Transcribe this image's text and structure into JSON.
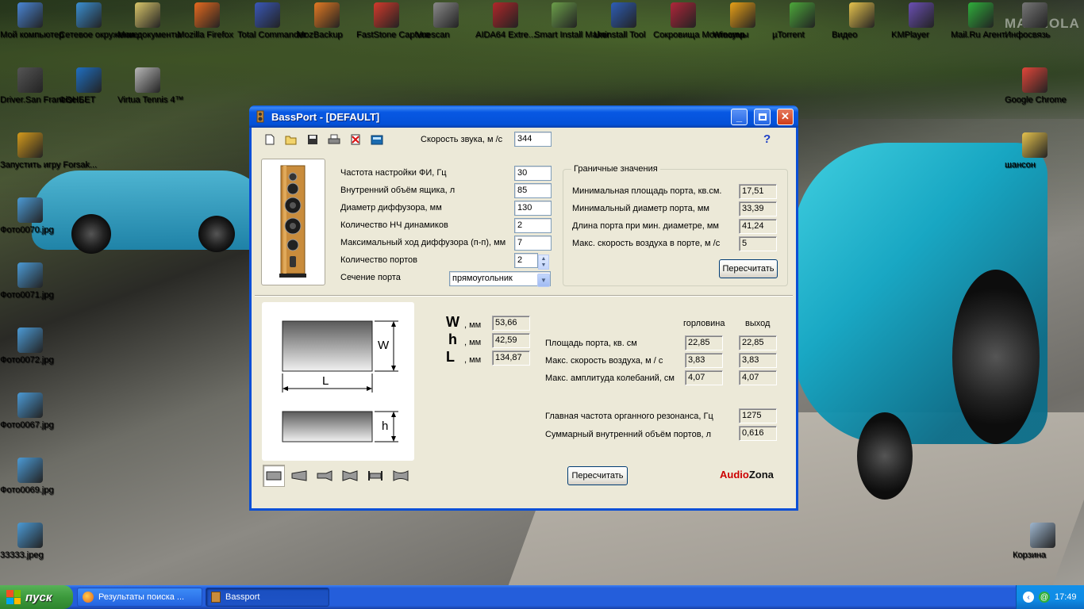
{
  "desktop": {
    "icons": [
      {
        "label": "Мой компьютер",
        "icon": "my-computer-icon",
        "color": "#4a86d6"
      },
      {
        "label": "Сетевое окружение",
        "icon": "network-icon",
        "color": "#3b8fd1"
      },
      {
        "label": "Мои документы",
        "icon": "documents-icon",
        "color": "#d9c66a"
      },
      {
        "label": "Mozilla Firefox",
        "icon": "firefox-icon",
        "color": "#e66a1f"
      },
      {
        "label": "Total Commander",
        "icon": "floppy-icon",
        "color": "#3a58b8"
      },
      {
        "label": "MozBackup",
        "icon": "mozbackup-icon",
        "color": "#e37a23"
      },
      {
        "label": "FastStone Capture",
        "icon": "faststone-icon",
        "color": "#d33a2c"
      },
      {
        "label": "Vuescan",
        "icon": "scanner-icon",
        "color": "#8a8a8a"
      },
      {
        "label": "AIDA64 Extre...",
        "icon": "aida64-icon",
        "color": "#b0272a"
      },
      {
        "label": "Smart Install Maker",
        "icon": "installer-icon",
        "color": "#6ca04a"
      },
      {
        "label": "Uninstall Tool",
        "icon": "uninstall-icon",
        "color": "#2e5db5"
      },
      {
        "label": "Сокровища Монтесумы",
        "icon": "game-icon",
        "color": "#b0263a"
      },
      {
        "label": "Winamp",
        "icon": "winamp-icon",
        "color": "#e8a017"
      },
      {
        "label": "µTorrent",
        "icon": "utorrent-icon",
        "color": "#4ca83a"
      },
      {
        "label": "Видео",
        "icon": "folder-icon",
        "color": "#e6c34d"
      },
      {
        "label": "KMPlayer",
        "icon": "kmplayer-icon",
        "color": "#6a4fb3"
      },
      {
        "label": "Mail.Ru Агент",
        "icon": "mailru-agent-icon",
        "color": "#2fae3b"
      },
      {
        "label": "Инфосвязь",
        "icon": "infosvyaz-icon",
        "color": "#777777"
      },
      {
        "label": "Driver.San Francisc...",
        "icon": "driver-game-icon",
        "color": "#555555"
      },
      {
        "label": "ФОНБЕТ",
        "icon": "fonbet-icon",
        "color": "#1f6fc2"
      },
      {
        "label": "Virtua Tennis 4™",
        "icon": "tennis-game-icon",
        "color": "#b8b8b8"
      },
      {
        "label": "Запустить игру Forsak...",
        "icon": "forsaken-game-icon",
        "color": "#d59b1c"
      },
      {
        "label": "Фото0070.jpg",
        "icon": "image-file-icon",
        "color": "#4c9bd6"
      },
      {
        "label": "Фото0071.jpg",
        "icon": "image-file-icon",
        "color": "#4c9bd6"
      },
      {
        "label": "Фото0072.jpg",
        "icon": "image-file-icon",
        "color": "#4c9bd6"
      },
      {
        "label": "Фото0067.jpg",
        "icon": "image-file-icon",
        "color": "#4c9bd6"
      },
      {
        "label": "Фото0069.jpg",
        "icon": "image-file-icon",
        "color": "#4c9bd6"
      },
      {
        "label": "33333.jpeg",
        "icon": "image-file-icon",
        "color": "#4c9bd6"
      },
      {
        "label": "Google Chrome",
        "icon": "chrome-icon",
        "color": "#e2463a"
      },
      {
        "label": "шансон",
        "icon": "folder-icon",
        "color": "#e6c34d"
      },
      {
        "label": "Корзина",
        "icon": "recycle-bin-icon",
        "color": "#9fb7cf"
      }
    ]
  },
  "window": {
    "title": "BassPort - [DEFAULT]",
    "sound_speed_label": "Скорость звука, м /с",
    "sound_speed_value": "344",
    "help": "?",
    "params": [
      {
        "label": "Частота настройки ФИ, Гц",
        "value": "30"
      },
      {
        "label": "Внутренний объём ящика, л",
        "value": "85"
      },
      {
        "label": "Диаметр диффузора, мм",
        "value": "130"
      },
      {
        "label": "Количество НЧ динамиков",
        "value": "2"
      },
      {
        "label": "Максимальный ход диффузора (п-п), мм",
        "value": "7"
      },
      {
        "label": "Количество портов",
        "value": "2"
      },
      {
        "label": "Сечение порта",
        "value": "прямоугольник"
      }
    ],
    "limits": {
      "title": "Граничные значения",
      "rows": [
        {
          "label": "Минимальная площадь порта, кв.см.",
          "value": "17,51"
        },
        {
          "label": "Минимальный диаметр порта, мм",
          "value": "33,39"
        },
        {
          "label": "Длина порта при мин. диаметре, мм",
          "value": "41,24"
        },
        {
          "label": "Макс. скорость воздуха в порте, м /с",
          "value": "5"
        }
      ],
      "recalc": "Пересчитать"
    },
    "diagram": {
      "w": "W",
      "l": "L",
      "h": "h"
    },
    "dims": [
      {
        "letter": "W",
        "unit": ", мм",
        "value": "53,66"
      },
      {
        "letter": "h",
        "unit": ", мм",
        "value": "42,59"
      },
      {
        "letter": "L",
        "unit": ", мм",
        "value": "134,87"
      }
    ],
    "results": {
      "col_throat": "горловина",
      "col_exit": "выход",
      "rows": [
        {
          "label": "Площадь порта, кв. см",
          "throat": "22,85",
          "exit": "22,85"
        },
        {
          "label": "Макс. скорость воздуха, м / с",
          "throat": "3,83",
          "exit": "3,83"
        },
        {
          "label": "Макс. амплитуда колебаний, см",
          "throat": "4,07",
          "exit": "4,07"
        }
      ],
      "organ_label": "Главная частота органного резонанса, Гц",
      "organ_value": "1275",
      "volume_label": "Суммарный внутренний объём портов, л",
      "volume_value": "0,616"
    },
    "recalc_bottom": "Пересчитать",
    "brand_part1": "Audio",
    "brand_part2": "Zona"
  },
  "taskbar": {
    "start": "пуск",
    "tasks": [
      {
        "label": "Результаты поиска ...",
        "active": false
      },
      {
        "label": "Bassport",
        "active": true
      }
    ],
    "clock": "17:49"
  },
  "watermark": "MAGNOLA"
}
